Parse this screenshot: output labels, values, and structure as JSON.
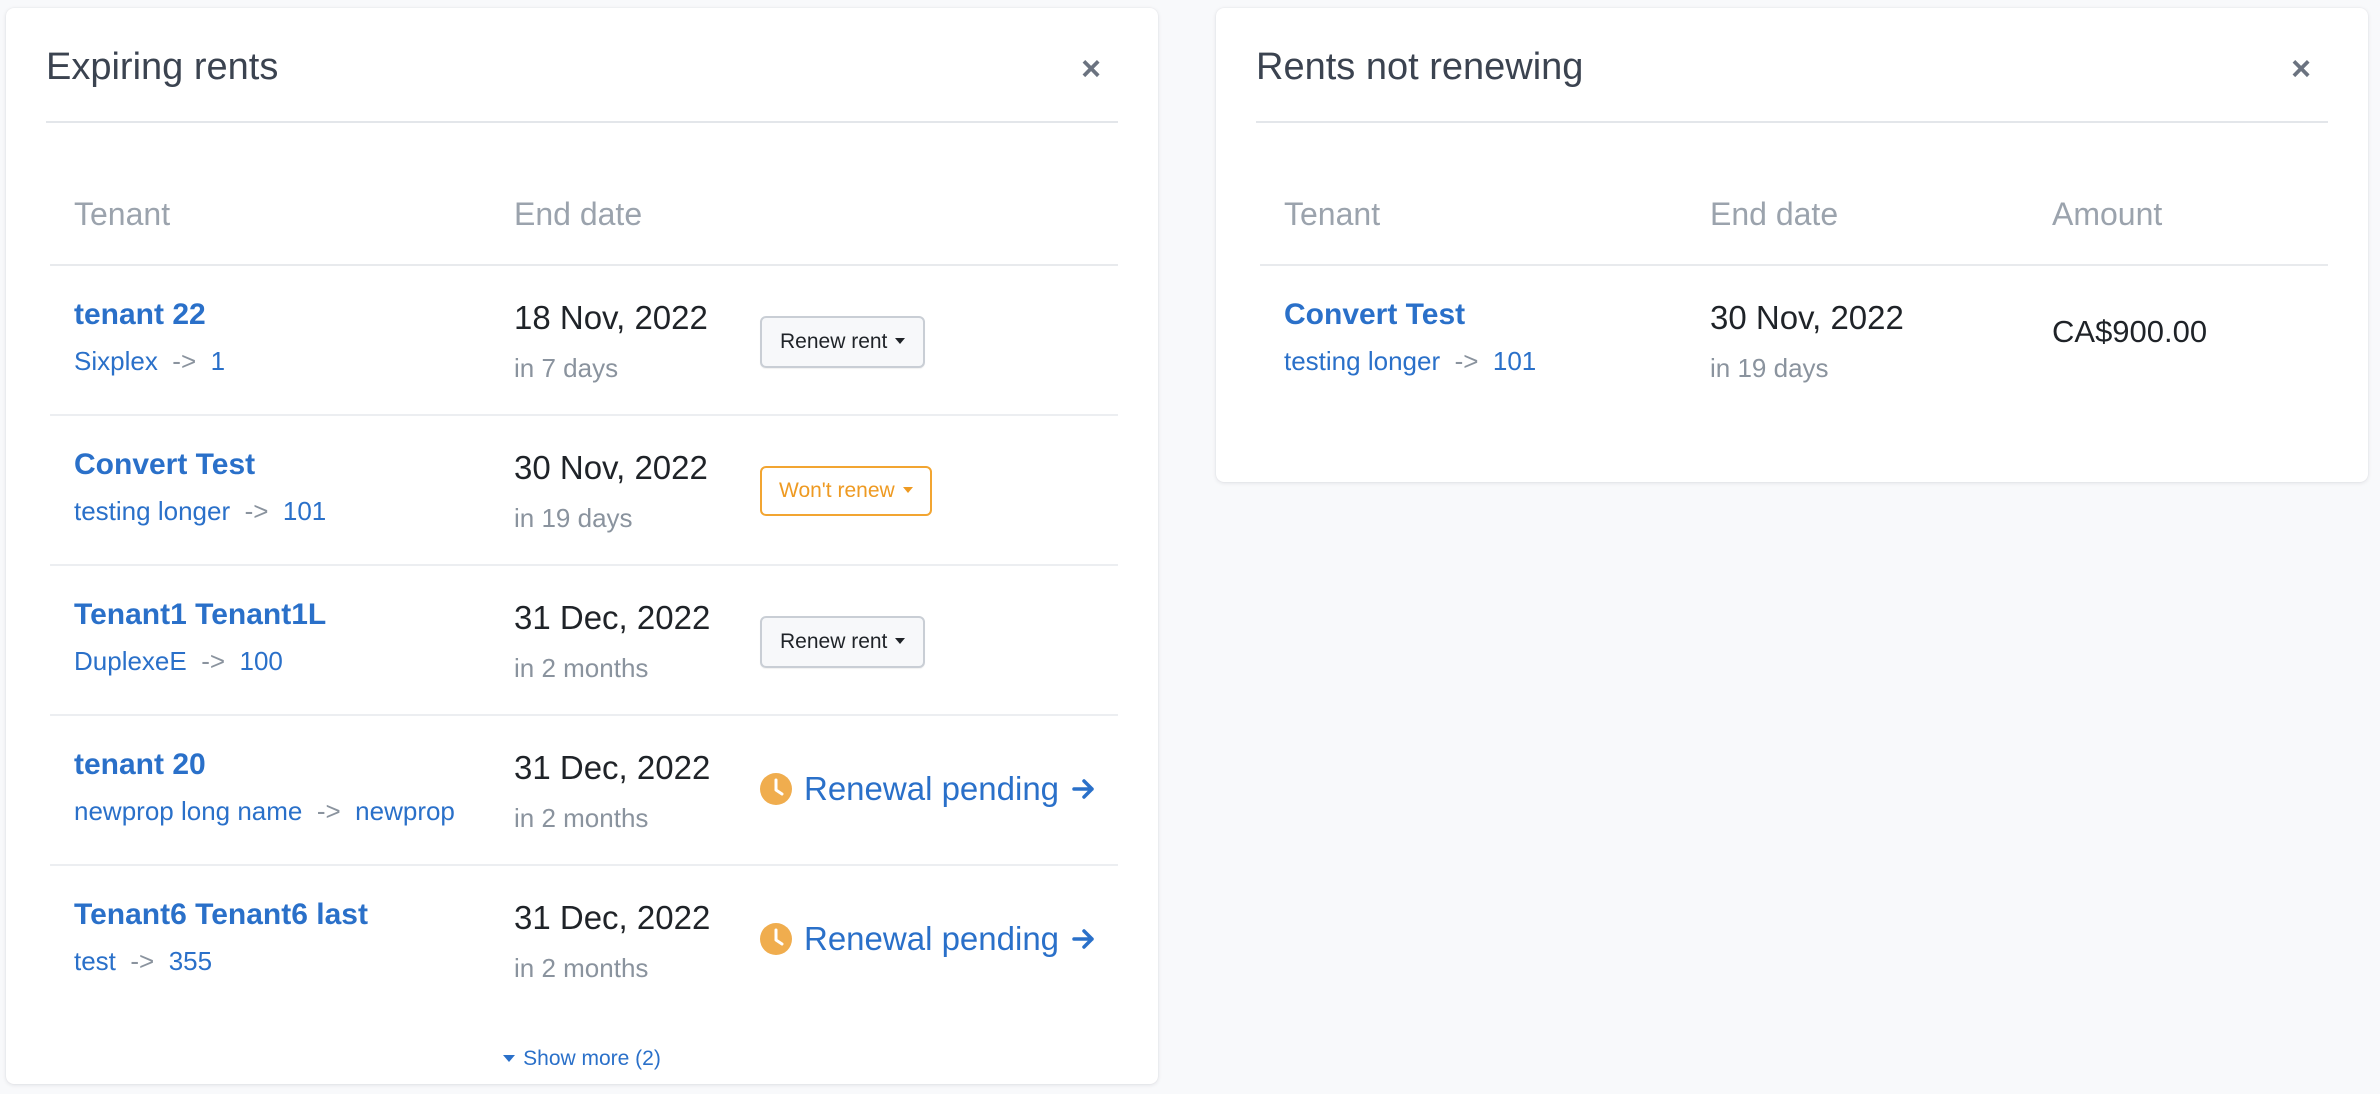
{
  "expiring": {
    "title": "Expiring rents",
    "close_label": "×",
    "columns": {
      "tenant": "Tenant",
      "end_date": "End date"
    },
    "rows": [
      {
        "name": "tenant 22",
        "property": "Sixplex",
        "unit": "1",
        "end_date": "18 Nov, 2022",
        "relative": "in 7 days",
        "action": "Renew rent"
      },
      {
        "name": "Convert Test",
        "property": "testing longer",
        "unit": "101",
        "end_date": "30 Nov, 2022",
        "relative": "in 19 days",
        "action": "Won't renew"
      },
      {
        "name": "Tenant1 Tenant1L",
        "property": "DuplexeE",
        "unit": "100",
        "end_date": "31 Dec, 2022",
        "relative": "in 2 months",
        "action": "Renew rent"
      },
      {
        "name": "tenant 20",
        "property": "newprop long name",
        "unit": "newprop",
        "end_date": "31 Dec, 2022",
        "relative": "in 2 months",
        "action": "Renewal pending"
      },
      {
        "name": "Tenant6 Tenant6 last",
        "property": "test",
        "unit": "355",
        "end_date": "31 Dec, 2022",
        "relative": "in 2 months",
        "action": "Renewal pending"
      }
    ],
    "arrow_sep": "->",
    "show_more": "Show more (2)"
  },
  "not_renewing": {
    "title": "Rents not renewing",
    "close_label": "×",
    "columns": {
      "tenant": "Tenant",
      "end_date": "End date",
      "amount": "Amount"
    },
    "rows": [
      {
        "name": "Convert Test",
        "property": "testing longer",
        "unit": "101",
        "end_date": "30 Nov, 2022",
        "relative": "in 19 days",
        "amount": "CA$900.00"
      }
    ],
    "arrow_sep": "->"
  },
  "icons": {
    "close": "close-icon",
    "caret": "caret-down-icon",
    "clock": "clock-icon",
    "arrow": "arrow-right-icon"
  },
  "colors": {
    "link": "#2a70c9",
    "warning": "#f2a531",
    "muted": "#8a939e",
    "clock": "#f0ad4e"
  }
}
